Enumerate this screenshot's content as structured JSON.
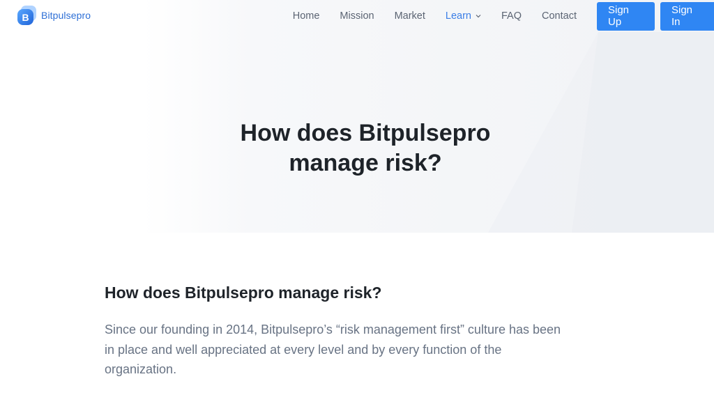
{
  "brand": {
    "name": "Bitpulsepro",
    "logo_letter": "B",
    "accent_color": "#2f86f3"
  },
  "nav": {
    "items": [
      {
        "label": "Home"
      },
      {
        "label": "Mission"
      },
      {
        "label": "Market"
      },
      {
        "label": "Learn",
        "has_dropdown": true,
        "active": true
      },
      {
        "label": "FAQ"
      },
      {
        "label": "Contact"
      }
    ],
    "signup_label": "Sign Up",
    "signin_label": "Sign In"
  },
  "hero": {
    "title_line1": "How does Bitpulsepro",
    "title_line2": "manage risk?"
  },
  "content": {
    "heading": "How does Bitpulsepro manage risk?",
    "paragraph_line1": "Since our founding in 2014, Bitpulsepro’s “risk management first” culture has been",
    "paragraph_line2": "in place and well appreciated at every level and by every function of the",
    "paragraph_line3": "organization."
  }
}
